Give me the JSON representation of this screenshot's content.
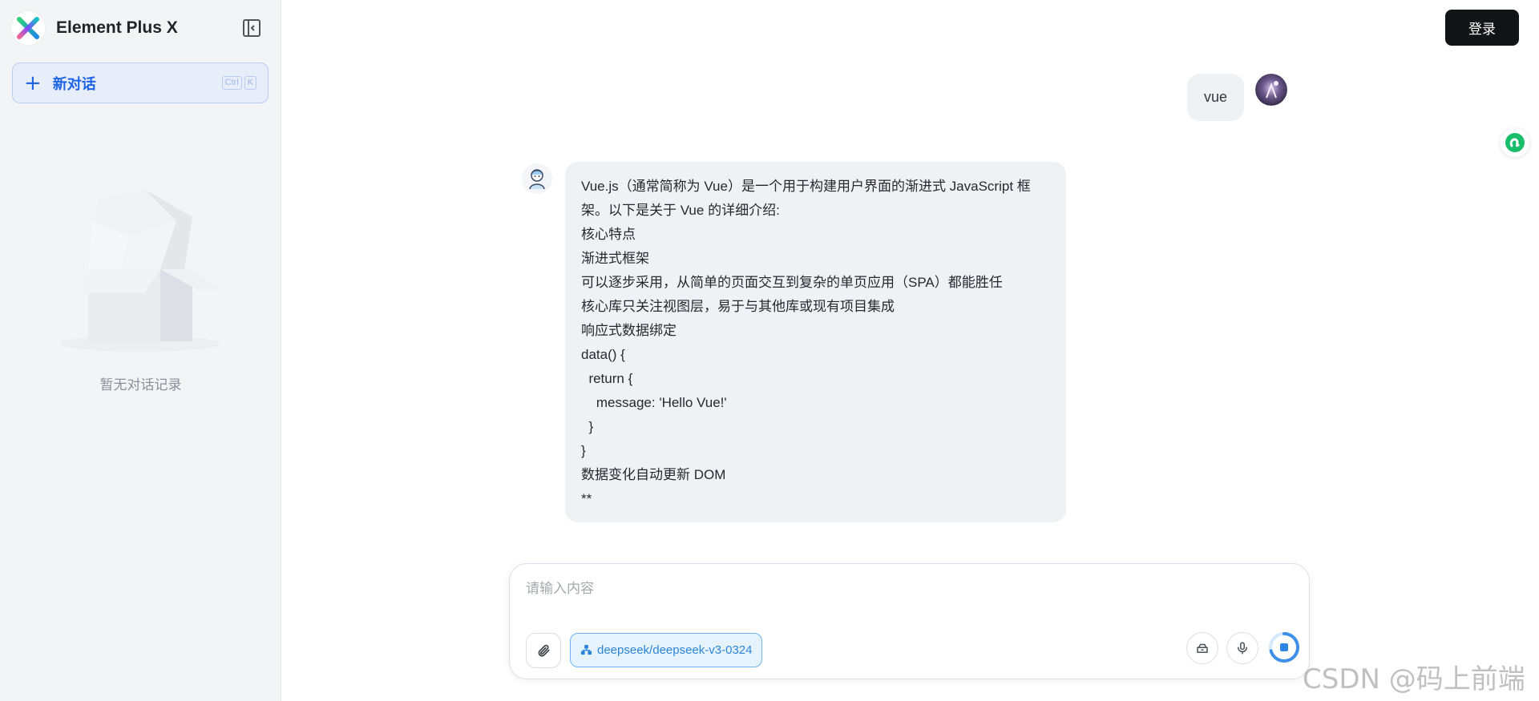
{
  "sidebar": {
    "brand_title": "Element Plus X",
    "new_chat_label": "新对话",
    "shortcut_keys": [
      "Ctrl",
      "K"
    ],
    "empty_text": "暂无对话记录"
  },
  "header": {
    "login_label": "登录"
  },
  "conversation": {
    "user_message": "vue",
    "ai_lines": [
      "Vue.js（通常简称为 Vue）是一个用于构建用户界面的渐进式 JavaScript 框",
      "架。以下是关于 Vue 的详细介绍:",
      "核心特点",
      "渐进式框架",
      "可以逐步采用，从简单的页面交互到复杂的单页应用（SPA）都能胜任",
      "核心库只关注视图层，易于与其他库或现有项目集成",
      "响应式数据绑定",
      "data() {",
      "  return {",
      "    message: 'Hello Vue!'",
      "  }",
      "}",
      "数据变化自动更新 DOM",
      "**"
    ]
  },
  "composer": {
    "placeholder": "请输入内容",
    "model_name": "deepseek/deepseek-v3-0324"
  },
  "watermark": "CSDN @码上前端",
  "colors": {
    "accent": "#1e64e6",
    "login_bg": "#131417",
    "model_chip": "#2b84d6"
  }
}
